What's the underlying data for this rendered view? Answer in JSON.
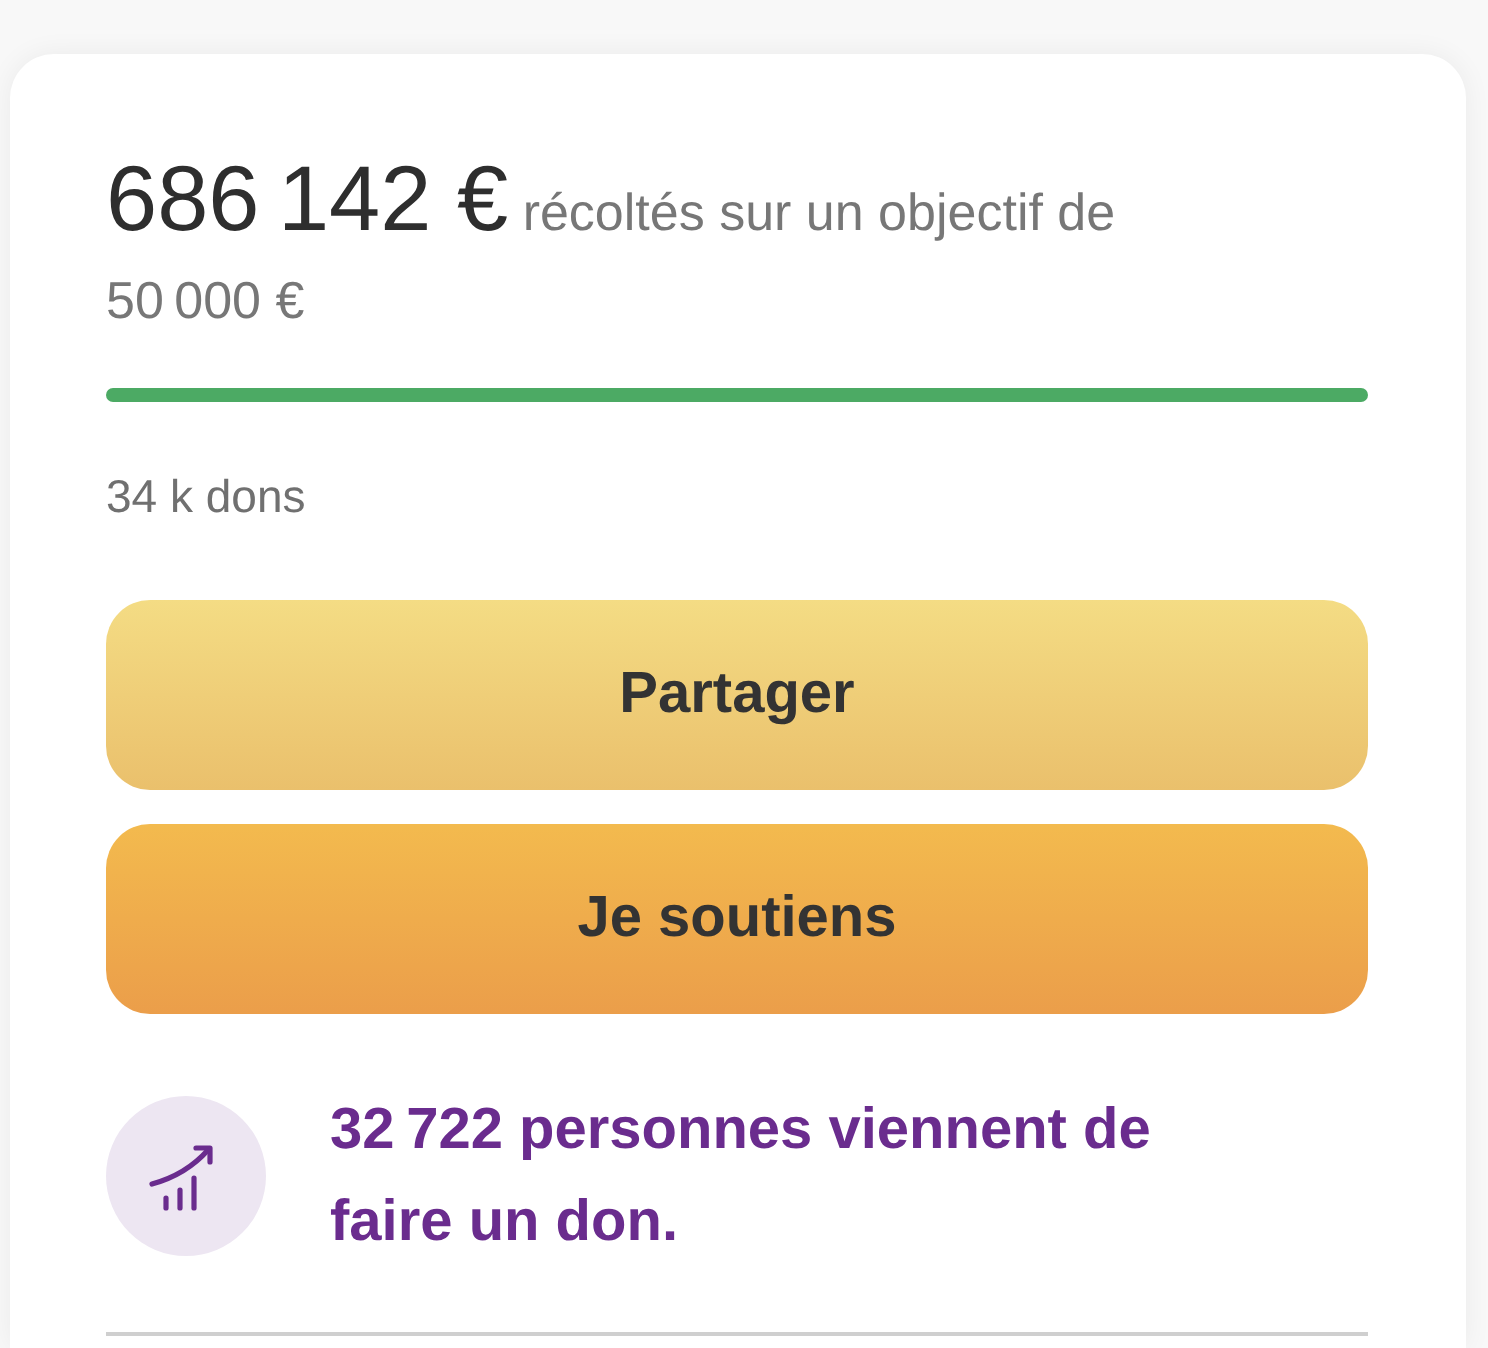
{
  "funding": {
    "raised": "686 142 €",
    "goal_text": "récoltés sur un objectif de 50 000 €",
    "progress": {
      "level": 1
    },
    "donations": "34 k dons"
  },
  "buttons": [
    {
      "label": "Partager",
      "kind": "secondary"
    },
    {
      "label": "Je soutiens",
      "kind": "primary"
    }
  ],
  "activity": {
    "message": "32 722 personnes viennent de faire un don."
  }
}
